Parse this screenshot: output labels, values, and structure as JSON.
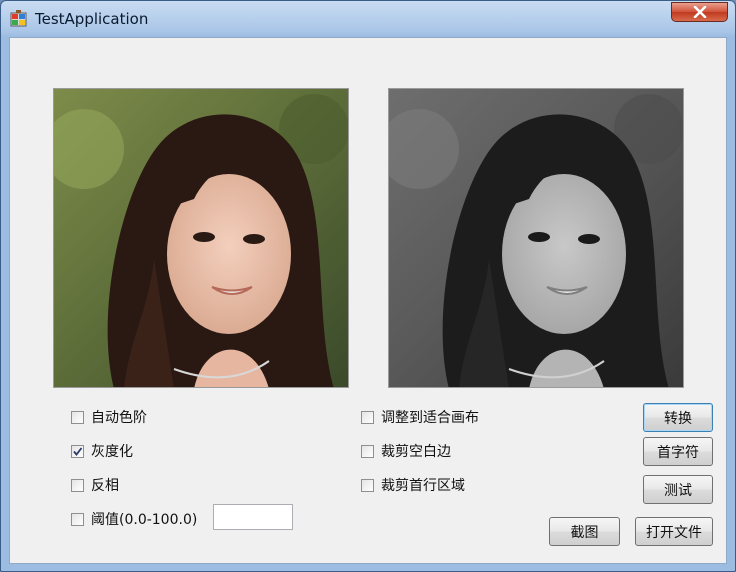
{
  "window": {
    "title": "TestApplication"
  },
  "options_left": [
    {
      "label": "自动色阶",
      "checked": false
    },
    {
      "label": "灰度化",
      "checked": true
    },
    {
      "label": "反相",
      "checked": false
    },
    {
      "label": "阈值(0.0-100.0)",
      "checked": false
    }
  ],
  "threshold_input": {
    "value": ""
  },
  "options_right": [
    {
      "label": "调整到适合画布",
      "checked": false
    },
    {
      "label": "裁剪空白边",
      "checked": false
    },
    {
      "label": "裁剪首行区域",
      "checked": false
    }
  ],
  "buttons": {
    "convert": "转换",
    "initials": "首字符",
    "test": "测试",
    "screenshot": "截图",
    "open_file": "打开文件"
  }
}
